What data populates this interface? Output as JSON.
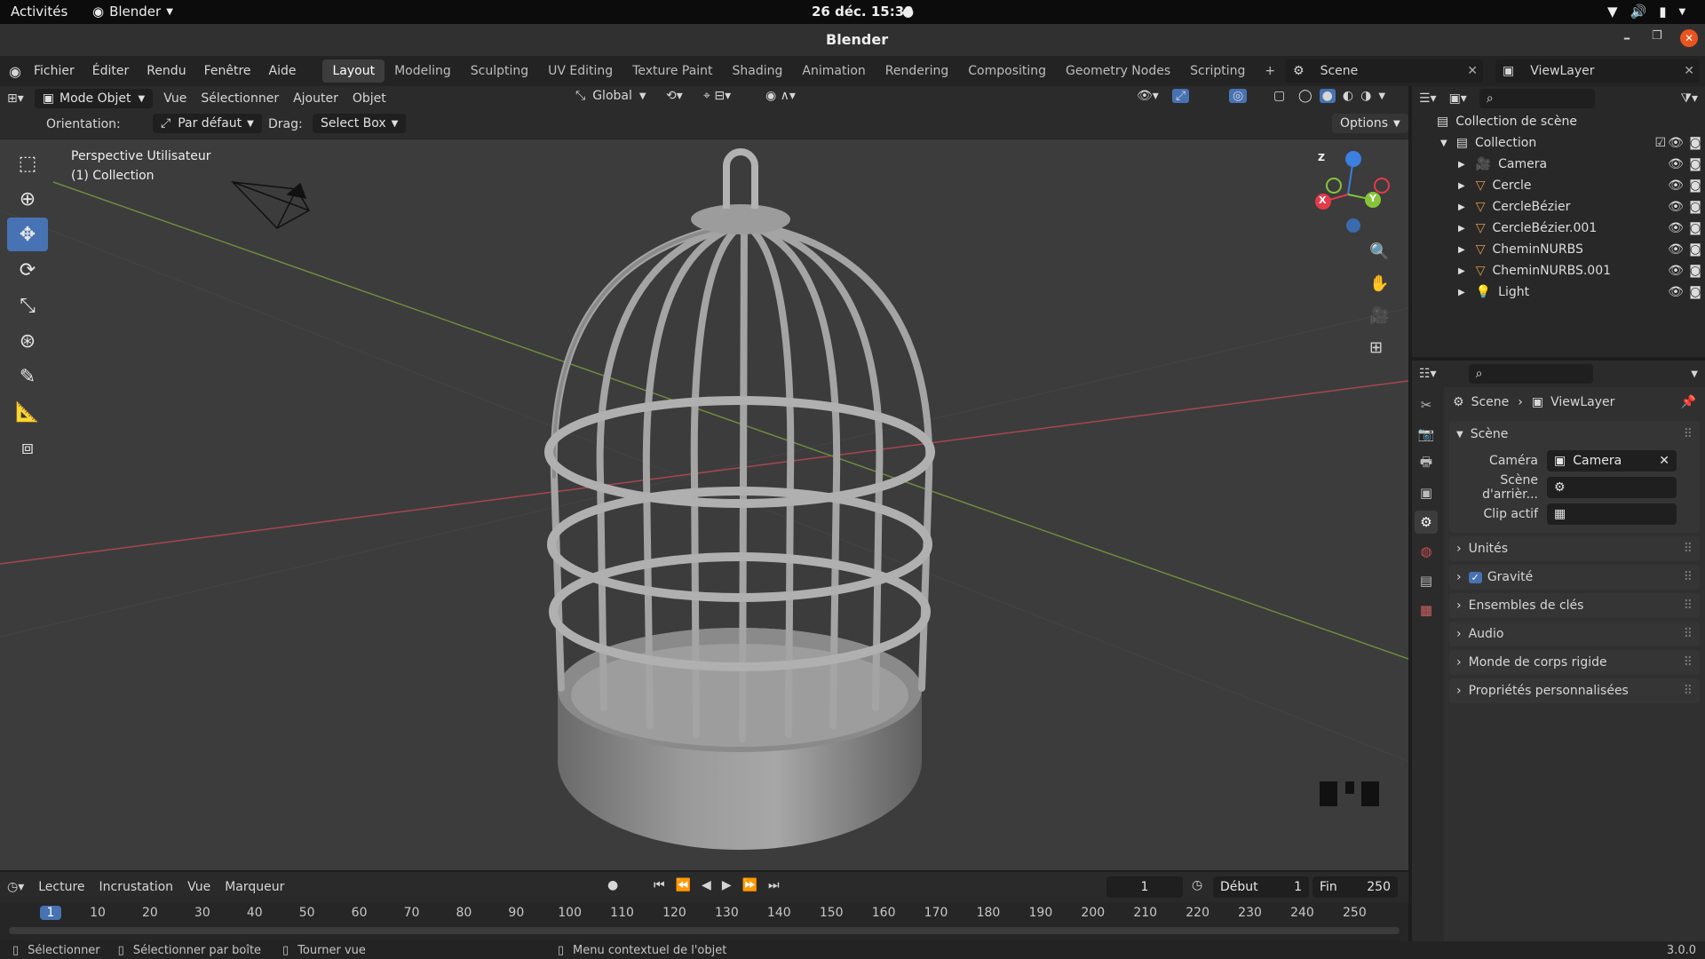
{
  "gnome": {
    "activities": "Activités",
    "app": "Blender",
    "clock": "26 déc.  15:39"
  },
  "window": {
    "title": "Blender"
  },
  "menu": [
    "Fichier",
    "Éditer",
    "Rendu",
    "Fenêtre",
    "Aide"
  ],
  "workspaces": [
    "Layout",
    "Modeling",
    "Sculpting",
    "UV Editing",
    "Texture Paint",
    "Shading",
    "Animation",
    "Rendering",
    "Compositing",
    "Geometry Nodes",
    "Scripting"
  ],
  "active_workspace": "Layout",
  "scene": {
    "name": "Scene",
    "viewlayer": "ViewLayer"
  },
  "viewport_header": {
    "mode": "Mode Objet",
    "menus": [
      "Vue",
      "Sélectionner",
      "Ajouter",
      "Objet"
    ],
    "transform": "Global",
    "options": "Options"
  },
  "tool_settings": {
    "orientation_label": "Orientation:",
    "orientation_value": "Par défaut",
    "drag_label": "Drag:",
    "drag_value": "Select Box"
  },
  "viewport": {
    "view_name": "Perspective Utilisateur",
    "collection": "(1) Collection",
    "axes": {
      "x": "X",
      "y": "Y",
      "z": "Z"
    }
  },
  "outliner": {
    "root": "Collection de scène",
    "collection": "Collection",
    "items": [
      "Camera",
      "Cercle",
      "CercleBézier",
      "CercleBézier.001",
      "CheminNURBS",
      "CheminNURBS.001",
      "Light"
    ]
  },
  "properties": {
    "breadcrumb": [
      "Scene",
      "ViewLayer"
    ],
    "section": "Scène",
    "fields": [
      {
        "label": "Caméra",
        "value": "Camera"
      },
      {
        "label": "Scène d'arrièr...",
        "value": ""
      },
      {
        "label": "Clip actif",
        "value": ""
      }
    ],
    "panels": [
      "Unités",
      "Gravité",
      "Ensembles de clés",
      "Audio",
      "Monde de corps rigide",
      "Propriétés personnalisées"
    ]
  },
  "timeline": {
    "menus": [
      "Lecture",
      "Incrustation",
      "Vue",
      "Marqueur"
    ],
    "current_frame": "1",
    "start_label": "Début",
    "start": "1",
    "end_label": "Fin",
    "end": "250",
    "ticks": [
      "1",
      "10",
      "20",
      "30",
      "40",
      "50",
      "60",
      "70",
      "80",
      "90",
      "100",
      "110",
      "120",
      "130",
      "140",
      "150",
      "160",
      "170",
      "180",
      "190",
      "200",
      "210",
      "220",
      "230",
      "240",
      "250"
    ]
  },
  "status": {
    "select": "Sélectionner",
    "box_select": "Sélectionner par boîte",
    "rotate": "Tourner vue",
    "context": "Menu contextuel de l'objet",
    "version": "3.0.0"
  },
  "colors": {
    "accent": "#4772b3",
    "x_axis": "#e23b4a",
    "y_axis": "#86c43a",
    "z_axis": "#3b7fe0"
  }
}
